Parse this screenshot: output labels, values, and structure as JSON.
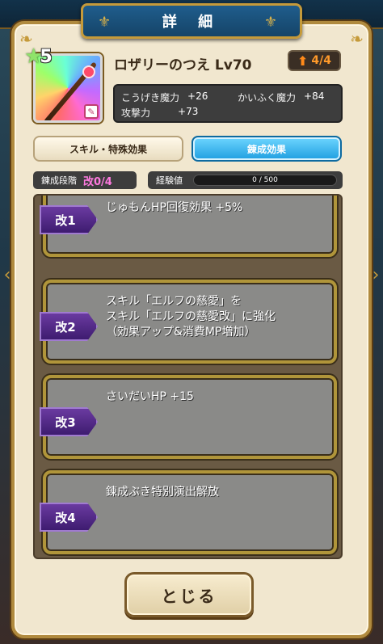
{
  "dialog": {
    "title": "詳 細",
    "close_label": "とじる"
  },
  "weapon": {
    "name": "ロザリーのつえ Lv70",
    "rarity": "5",
    "icon": "rosary-staff-icon",
    "upgrade_count": "4/4",
    "stats": [
      {
        "label": "こうげき魔力",
        "value": "+26"
      },
      {
        "label": "かいふく魔力",
        "value": "+84"
      },
      {
        "label": "攻撃力",
        "value": "+73"
      }
    ]
  },
  "tabs": {
    "skills": "スキル・特殊効果",
    "refine": "錬成効果"
  },
  "refine": {
    "stage_label": "錬成段階",
    "stage_value": "改0/4",
    "exp_label": "経験値",
    "exp_value": "0 / 500",
    "exp_fraction": 0
  },
  "effects": [
    {
      "tag": "改1",
      "lines": [
        "じゅもんHP回復効果 +5%"
      ]
    },
    {
      "tag": "改2",
      "lines": [
        "スキル「エルフの慈愛」を",
        "スキル「エルフの慈愛改」に強化",
        "（効果アップ&消費MP増加）"
      ]
    },
    {
      "tag": "改3",
      "lines": [
        "さいだいHP +15"
      ]
    },
    {
      "tag": "改4",
      "lines": [
        "錬成ぶき特別演出解放"
      ]
    }
  ],
  "colors": {
    "accent_blue": "#1e9ee0",
    "frame_gold": "#b0953a",
    "tag_purple": "#4e2a88"
  }
}
